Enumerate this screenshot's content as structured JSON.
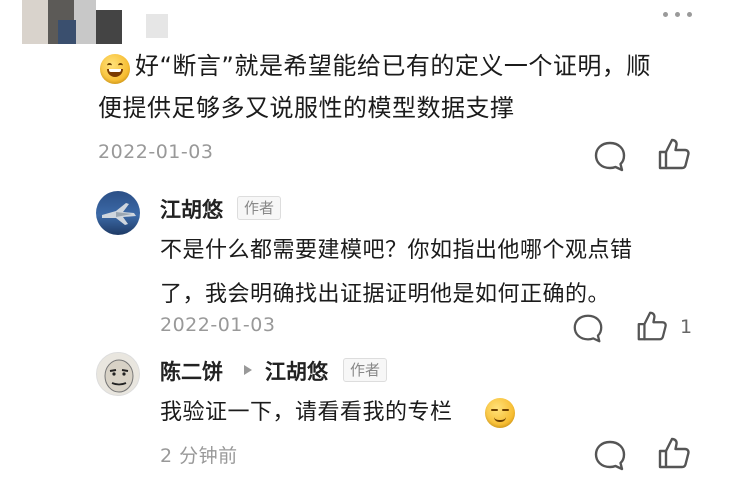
{
  "top_comment": {
    "text_line1": "好“断言”就是希望能给已有的定义一个证明，顺",
    "text_line2": "便提供足够多又说服性的模型数据支撑",
    "date": "2022-01-03"
  },
  "replies": [
    {
      "author": "江胡悠",
      "author_badge": "作者",
      "text_line1": "不是什么都需要建模吧？你如指出他哪个观点错",
      "text_line2": "了，我会明确找出证据证明他是如何正确的。",
      "date": "2022-01-03",
      "like_count": "1"
    },
    {
      "author": "陈二饼",
      "reply_to": "江胡悠",
      "reply_to_badge": "作者",
      "text": "我验证一下，请看看我的专栏",
      "date": "2 分钟前"
    }
  ],
  "icons": {
    "more": "more-dots-icon",
    "comment": "comment-bubble-icon",
    "like": "thumbs-up-icon",
    "reply_arrow": "triangle-right-icon",
    "emoji_grin": "grinning-emoji",
    "emoji_smirk": "smirk-emoji"
  },
  "colors": {
    "text": "#1b1b1b",
    "meta": "#999999",
    "badge_border": "#dddddd",
    "emoji": "#f6b92b"
  }
}
